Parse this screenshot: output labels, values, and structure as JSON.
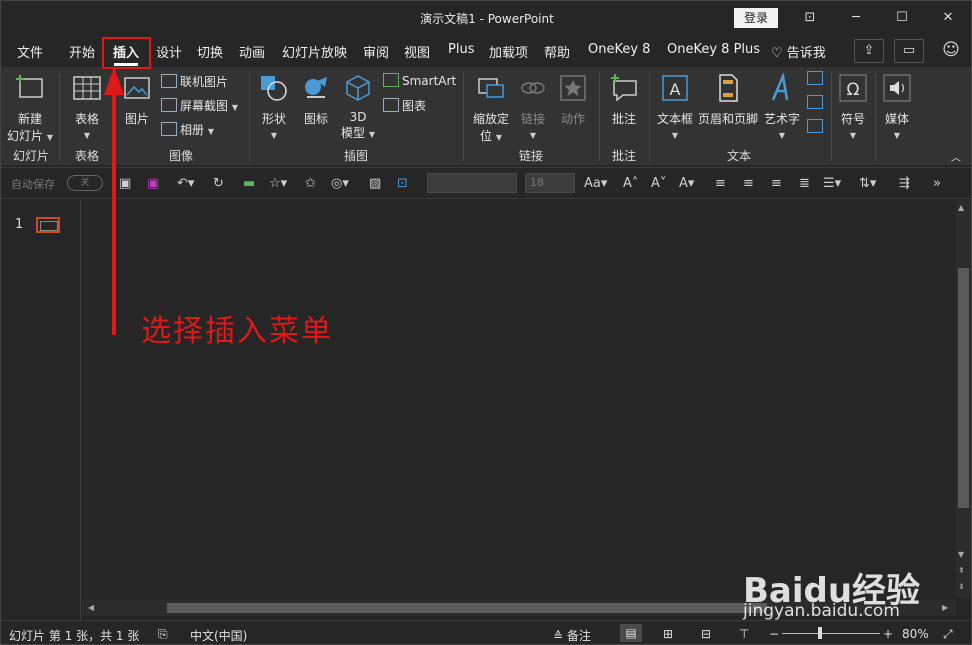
{
  "window": {
    "title": "演示文稿1  -  PowerPoint",
    "login_label": "登录",
    "controls": {
      "ribbon_display": "⊡",
      "minimize": "─",
      "maximize": "☐",
      "close": "✕"
    }
  },
  "menu": {
    "tabs": [
      "文件",
      "开始",
      "插入",
      "设计",
      "切换",
      "动画",
      "幻灯片放映",
      "审阅",
      "视图",
      "Plus",
      "加载项",
      "帮助",
      "OneKey 8",
      "OneKey 8 Plus"
    ],
    "active_tab": "插入",
    "tell_me": "告诉我"
  },
  "ribbon": {
    "groups": {
      "slides": "幻灯片",
      "tables": "表格",
      "images": "图像",
      "illustrations": "插图",
      "links": "链接",
      "comments": "批注",
      "text": "文本"
    },
    "buttons": {
      "new_slide_1": "新建",
      "new_slide_2": "幻灯片",
      "table": "表格",
      "picture": "图片",
      "online_picture": "联机图片",
      "screenshot": "屏幕截图",
      "album": "相册",
      "shapes": "形状",
      "icons": "图标",
      "model3d_1": "3D",
      "model3d_2": "模型",
      "smartart": "SmartArt",
      "chart": "图表",
      "zoom_1": "缩放定",
      "zoom_2": "位",
      "link": "链接",
      "action": "动作",
      "comment": "批注",
      "textbox": "文本框",
      "header_footer": "页眉和页脚",
      "wordart": "艺术字",
      "symbol": "符号",
      "media": "媒体"
    }
  },
  "quick_access": {
    "autosave_label": "自动保存",
    "autosave_state": "关",
    "font_size": "18"
  },
  "slides_pane": {
    "slide_number": "1"
  },
  "status_bar": {
    "slide_info": "幻灯片 第 1 张，共 1 张",
    "language": "中文(中国)",
    "notes": "备注",
    "zoom_minus": "−",
    "zoom_plus": "+",
    "zoom_level": "80%"
  },
  "annotation": {
    "text": "选择插入菜单"
  },
  "watermark": {
    "logo": "Baidu经验",
    "url": "jingyan.baidu.com"
  },
  "colors": {
    "accent_orange": "#d24726",
    "annotation_red": "#e01818",
    "icon_blue": "#4a9ad6",
    "background": "#262626",
    "ribbon": "#333333"
  }
}
